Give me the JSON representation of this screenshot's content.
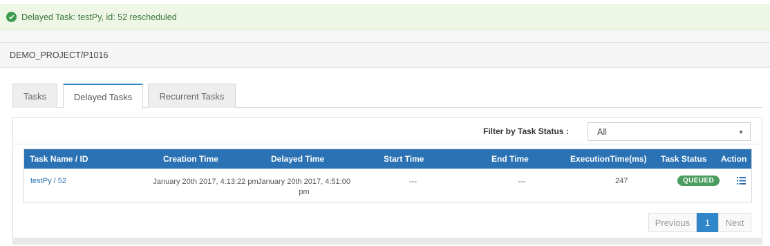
{
  "alert": {
    "message": "Delayed Task: testPy, id: 52 rescheduled",
    "icon": "check-circle-icon",
    "color": "#3c763d"
  },
  "breadcrumb": {
    "path": "DEMO_PROJECT/P1016"
  },
  "tabs": [
    {
      "label": "Tasks",
      "active": false
    },
    {
      "label": "Delayed Tasks",
      "active": true
    },
    {
      "label": "Recurrent Tasks",
      "active": false
    }
  ],
  "filter": {
    "label": "Filter by Task Status :",
    "selected": "All"
  },
  "table": {
    "headers": [
      "Task Name / ID",
      "Creation Time",
      "Delayed Time",
      "Start Time",
      "End Time",
      "ExecutionTime(ms)",
      "Task Status",
      "Action"
    ],
    "rows": [
      {
        "task": "testPy / 52",
        "creation_time": "January 20th 2017, 4:13:22 pm",
        "delayed_time": "January 20th 2017, 4:51:00 pm",
        "start_time": "---",
        "end_time": "---",
        "execution_time": "247",
        "status": "QUEUED",
        "action_icon": "list-icon"
      }
    ]
  },
  "pagination": {
    "previous": "Previous",
    "current": "1",
    "next": "Next"
  },
  "colors": {
    "header_bg": "#2a72b4",
    "accent": "#2f86c9",
    "status_queued": "#4a9d5f",
    "alert_bg": "#eef7e6"
  }
}
